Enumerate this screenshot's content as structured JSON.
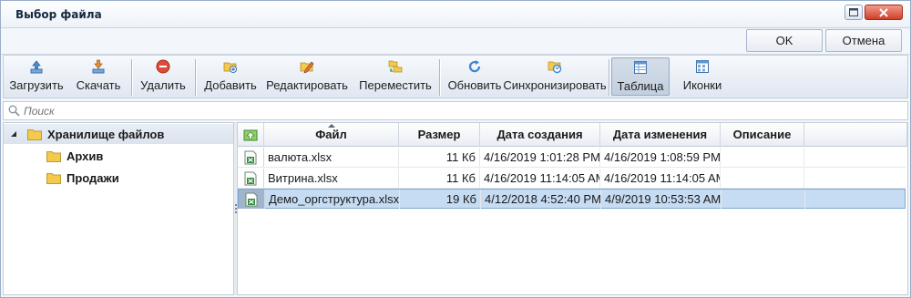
{
  "window": {
    "title": "Выбор файла"
  },
  "dialog": {
    "ok_label": "OK",
    "cancel_label": "Отмена"
  },
  "toolbar": {
    "upload": "Загрузить",
    "download": "Скачать",
    "delete": "Удалить",
    "add": "Добавить",
    "edit": "Редактировать",
    "move": "Переместить",
    "refresh": "Обновить",
    "sync": "Синхронизировать",
    "table": "Таблица",
    "icons": "Иконки",
    "active_view": "Таблица"
  },
  "search": {
    "placeholder": "Поиск",
    "value": ""
  },
  "tree": {
    "root": "Хранилище файлов",
    "children": [
      "Архив",
      "Продажи"
    ]
  },
  "grid": {
    "columns": [
      "Файл",
      "Размер",
      "Дата создания",
      "Дата изменения",
      "Описание"
    ],
    "rows": [
      {
        "name": "валюта.xlsx",
        "size": "11 Кб",
        "created": "4/16/2019 1:01:28 PM",
        "modified": "4/16/2019 1:08:59 PM",
        "description": ""
      },
      {
        "name": "Витрина.xlsx",
        "size": "11 Кб",
        "created": "4/16/2019 11:14:05 AM",
        "modified": "4/16/2019 11:14:05 AM",
        "description": ""
      },
      {
        "name": "Демо_оргструктура.xlsx",
        "size": "19 Кб",
        "created": "4/12/2018 4:52:40 PM",
        "modified": "4/9/2019 10:53:53 AM",
        "description": ""
      }
    ],
    "selected_row": 2
  },
  "colors": {
    "accent": "#c6dcf3",
    "folder": "#f3c94e",
    "excel": "#2f8a3a"
  }
}
